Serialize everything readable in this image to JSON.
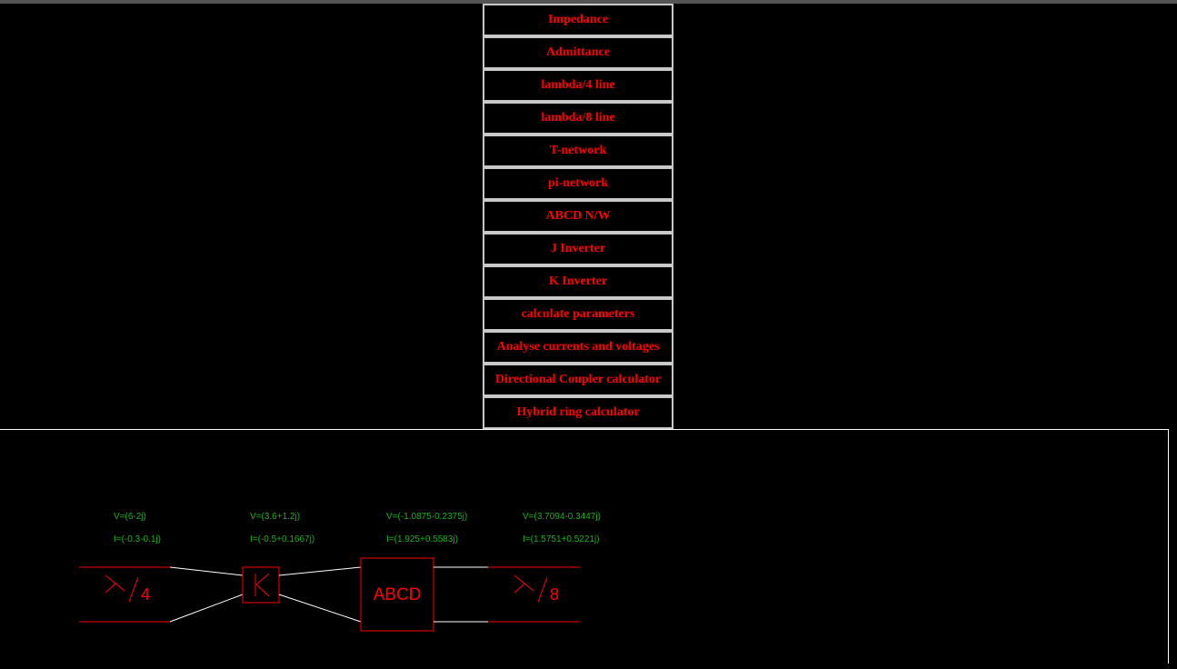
{
  "menu": {
    "items": [
      {
        "label": "Impedance"
      },
      {
        "label": "Admittance"
      },
      {
        "label": "lambda/4 line"
      },
      {
        "label": "lambda/8 line"
      },
      {
        "label": "T-network"
      },
      {
        "label": "pi-network"
      },
      {
        "label": "ABCD N/W"
      },
      {
        "label": "J Inverter"
      },
      {
        "label": "K Inverter"
      },
      {
        "label": "calculate parameters"
      },
      {
        "label": "Analyse currents and voltages"
      },
      {
        "label": "Directional Coupler calculator"
      },
      {
        "label": "Hybrid ring calculator"
      }
    ]
  },
  "circuit": {
    "nodes": [
      {
        "voltage": "V=(6-2j)",
        "current": "I=(-0.3-0.1j)"
      },
      {
        "voltage": "V=(3.6+1.2j)",
        "current": "I=(-0.5+0.1667j)"
      },
      {
        "voltage": "V=(-1.0875-0.2375j)",
        "current": "I=(1.925+0.5583j)"
      },
      {
        "voltage": "V=(3.7094-0.3447j)",
        "current": "I=(1.5751+0.5221j)"
      }
    ],
    "components": {
      "quarter_wave_denominator": "4",
      "k_inverter_label": "K",
      "abcd_label": "ABCD",
      "eighth_wave_denominator": "8"
    }
  },
  "colors": {
    "background": "#000000",
    "menu_text": "#ff0000",
    "menu_border": "#c8c8c8",
    "component": "#ff0000",
    "wire": "#ffffff",
    "readout": "#1fae1f"
  }
}
